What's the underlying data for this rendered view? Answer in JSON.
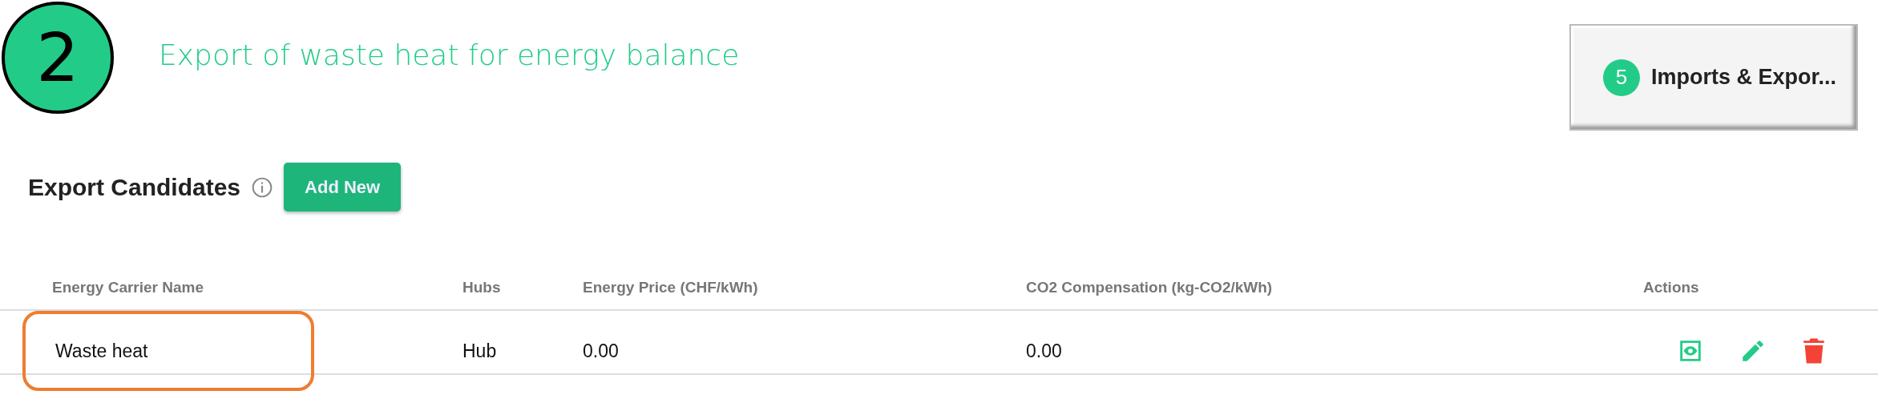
{
  "annotation": {
    "step": "2",
    "caption": "Export of waste heat for energy balance"
  },
  "nav_button": {
    "badge": "5",
    "label": "Imports & Expor..."
  },
  "section": {
    "title": "Export Candidates",
    "add_button": "Add New"
  },
  "table": {
    "columns": [
      "Energy Carrier Name",
      "Hubs",
      "Energy Price (CHF/kWh)",
      "CO2 Compensation (kg-CO2/kWh)",
      "Actions"
    ],
    "rows": [
      {
        "name": "Waste heat",
        "highlighted": true,
        "hubs": "Hub",
        "price": "0.00",
        "co2": "0.00",
        "actions": [
          {
            "kind": "view"
          },
          {
            "kind": "edit"
          },
          {
            "kind": "delete"
          }
        ]
      }
    ]
  }
}
